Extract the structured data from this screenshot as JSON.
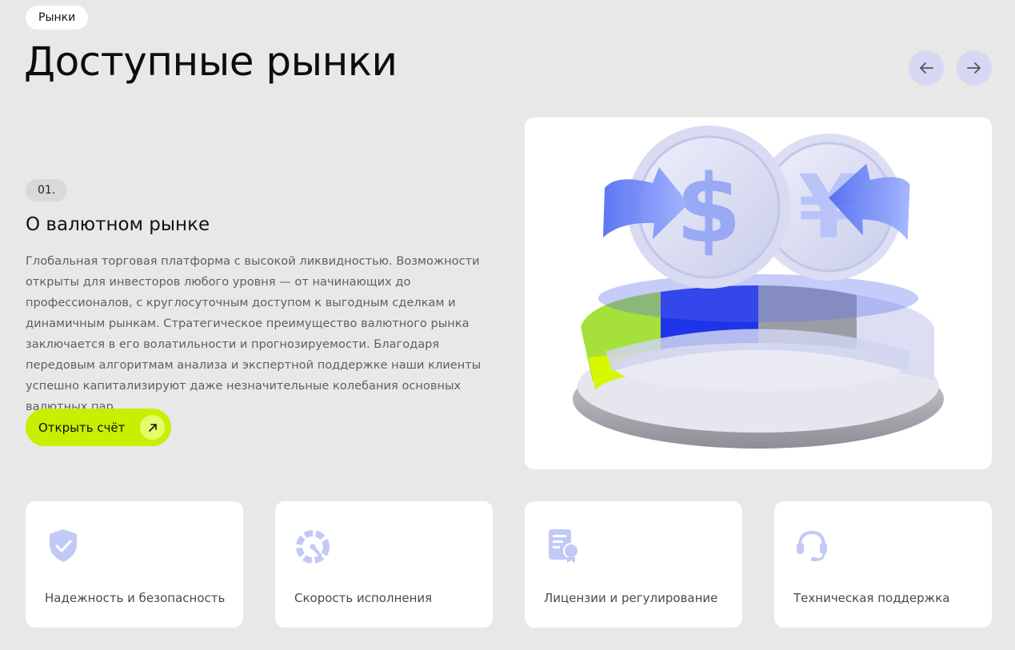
{
  "breadcrumb": {
    "label": "Рынки"
  },
  "page": {
    "title": "Доступные рынки"
  },
  "carousel": {
    "prev_icon": "arrow-left-icon",
    "next_icon": "arrow-right-icon"
  },
  "slide": {
    "number": "01.",
    "title": "О валютном рынке",
    "description": "Глобальная торговая платформа с высокой ликвидностью. Возможности открыты для инвесторов любого уровня — от начинающих до профессионалов, с круглосуточным доступом к выгодным сделкам и динамичным рынкам. Стратегическое преимущество валютного рынка заключается в его волатильности и прогнозируемости. Благодаря передовым алгоритмам анализа и экспертной поддержке наши клиенты успешно капитализируют даже незначительные колебания основных валютных пар.",
    "cta_label": "Открыть счёт",
    "cta_icon": "arrow-up-right-icon",
    "image": "currency-exchange-illustration"
  },
  "features": [
    {
      "label": "Надежность и безопасность",
      "icon": "shield-check-icon"
    },
    {
      "label": "Скорость исполнения",
      "icon": "speedometer-icon"
    },
    {
      "label": "Лицензии и регулирование",
      "icon": "certificate-icon"
    },
    {
      "label": "Техническая поддержка",
      "icon": "headset-icon"
    }
  ],
  "colors": {
    "background": "#e8e8e8",
    "accent": "#c6f000",
    "nav_button": "#d4d8f2",
    "icon": "#c2c9f6"
  }
}
